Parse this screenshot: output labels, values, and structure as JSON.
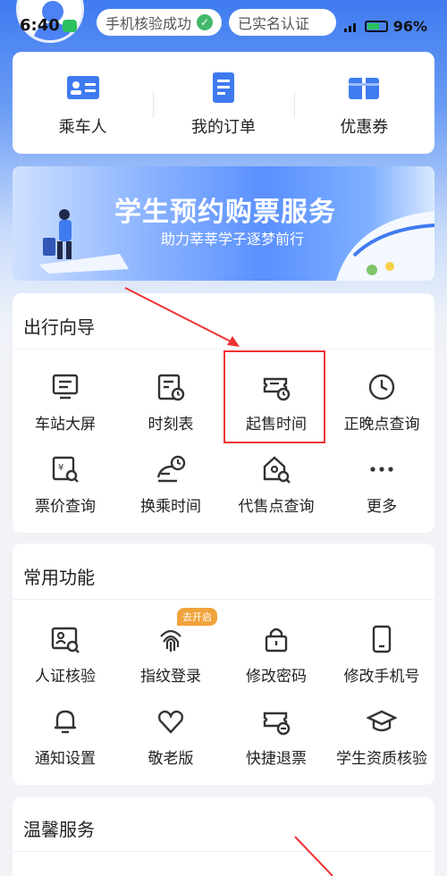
{
  "status_bar": {
    "time": "6:40",
    "chip_phone": "手机核验成功",
    "chip_realname": "已实名认证",
    "battery": "96%"
  },
  "quick": {
    "items": [
      {
        "label": "乘车人",
        "icon": "passenger-card-icon"
      },
      {
        "label": "我的订单",
        "icon": "order-document-icon"
      },
      {
        "label": "优惠券",
        "icon": "coupon-icon"
      }
    ]
  },
  "banner": {
    "title": "学生预约购票服务",
    "subtitle": "助力莘莘学子逐梦前行"
  },
  "guide": {
    "title": "出行向导",
    "items": [
      {
        "label": "车站大屏",
        "icon": "station-screen-icon"
      },
      {
        "label": "时刻表",
        "icon": "timetable-icon"
      },
      {
        "label": "起售时间",
        "icon": "sale-time-icon"
      },
      {
        "label": "正晚点查询",
        "icon": "clock-icon"
      },
      {
        "label": "票价查询",
        "icon": "fare-search-icon"
      },
      {
        "label": "换乘时间",
        "icon": "transfer-time-icon"
      },
      {
        "label": "代售点查询",
        "icon": "agency-search-icon"
      },
      {
        "label": "更多",
        "icon": "more-dots-icon"
      }
    ]
  },
  "common": {
    "title": "常用功能",
    "badge": "去开启",
    "items": [
      {
        "label": "人证核验",
        "icon": "id-verify-icon"
      },
      {
        "label": "指纹登录",
        "icon": "fingerprint-icon"
      },
      {
        "label": "修改密码",
        "icon": "lock-icon"
      },
      {
        "label": "修改手机号",
        "icon": "phone-icon"
      },
      {
        "label": "通知设置",
        "icon": "bell-icon"
      },
      {
        "label": "敬老版",
        "icon": "heart-icon"
      },
      {
        "label": "快捷退票",
        "icon": "refund-ticket-icon"
      },
      {
        "label": "学生资质核验",
        "icon": "graduation-cap-icon"
      }
    ]
  },
  "warm": {
    "title": "温馨服务"
  },
  "colors": {
    "accent": "#3f7bf0",
    "highlight": "#e33333",
    "badge": "#f0a33b"
  }
}
